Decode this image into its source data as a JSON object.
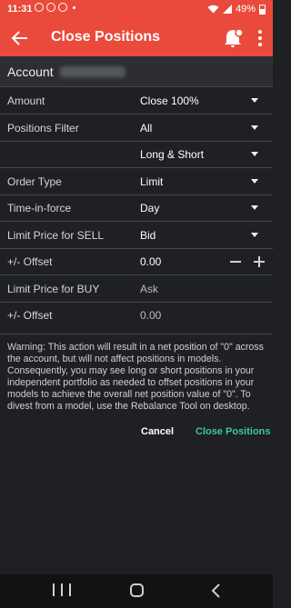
{
  "status_bar": {
    "time": "11:31",
    "battery": "49%"
  },
  "header": {
    "title": "Close Positions"
  },
  "account": {
    "label": "Account"
  },
  "form": {
    "amount": {
      "label": "Amount",
      "value": "Close 100%"
    },
    "positions_filter": {
      "label": "Positions Filter",
      "value": "All"
    },
    "direction": {
      "value": "Long & Short"
    },
    "order_type": {
      "label": "Order Type",
      "value": "Limit"
    },
    "time_in_force": {
      "label": "Time-in-force",
      "value": "Day"
    },
    "limit_sell": {
      "label": "Limit Price for SELL",
      "value": "Bid"
    },
    "offset_sell": {
      "label": "+/- Offset",
      "value": "0.00"
    },
    "limit_buy": {
      "label": "Limit Price for BUY",
      "value": "Ask"
    },
    "offset_buy": {
      "label": "+/- Offset",
      "value": "0.00"
    }
  },
  "warning": "Warning: This action will result in a net position of \"0\" across the account, but will not affect positions in models. Consequently, you may see long or short positions in your independent portfolio as needed to offset positions in your models to achieve the overall net position value of \"0\". To divest from a model, use the Rebalance Tool on desktop.",
  "actions": {
    "cancel": "Cancel",
    "confirm": "Close Positions"
  },
  "colors": {
    "accent": "#ea4a3b",
    "confirm": "#3ec5a5",
    "background": "#1e2023"
  }
}
